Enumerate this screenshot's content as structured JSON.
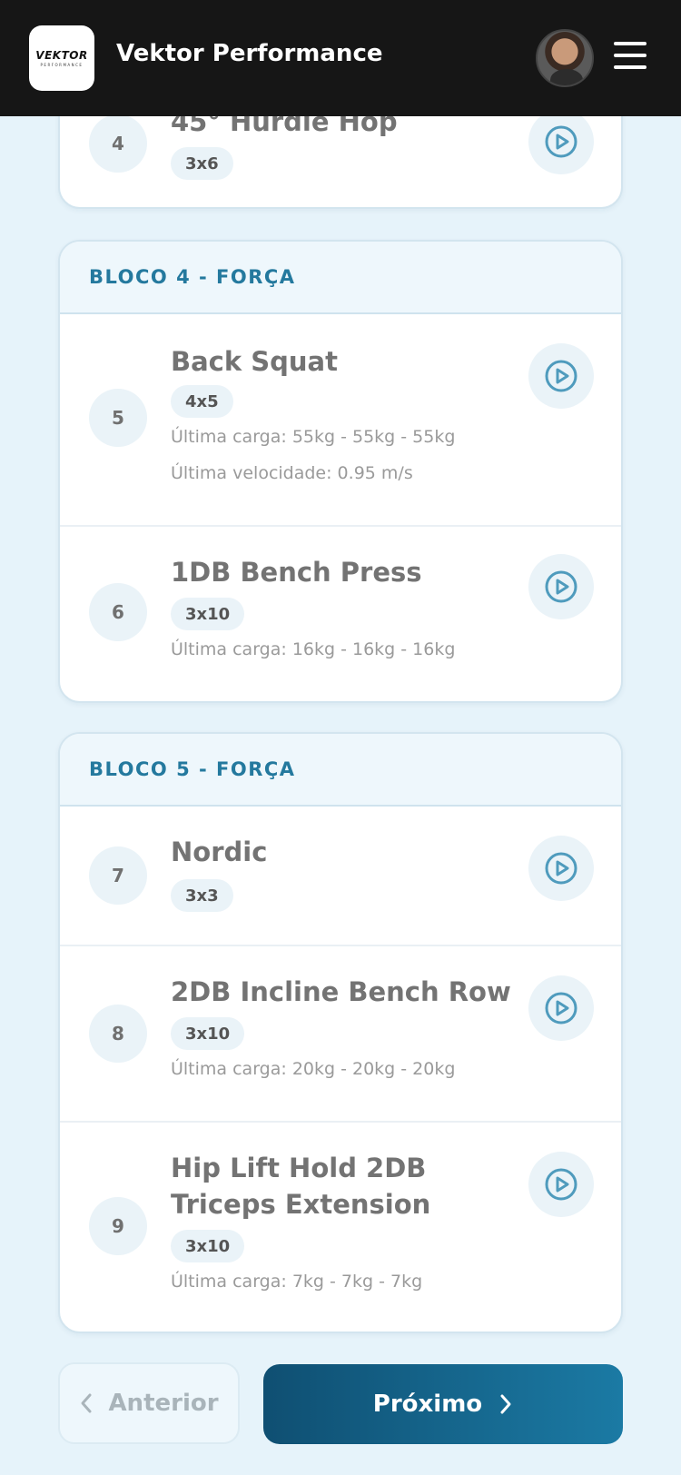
{
  "header": {
    "logo_text": "VEKTOR",
    "logo_subtext": "PERFORMANCE",
    "title": "Vektor Performance"
  },
  "top_card": {
    "exercise": {
      "number": "4",
      "name": "45° Hurdle Hop",
      "sets": "3x6"
    }
  },
  "blocks": [
    {
      "title": "BLOCO 4 - FORÇA",
      "exercises": [
        {
          "number": "5",
          "name": "Back Squat",
          "sets": "4x5",
          "last_load": "Última carga: 55kg - 55kg - 55kg",
          "last_velocity": "Última velocidade: 0.95 m/s"
        },
        {
          "number": "6",
          "name": "1DB Bench Press",
          "sets": "3x10",
          "last_load": "Última carga: 16kg - 16kg - 16kg"
        }
      ]
    },
    {
      "title": "BLOCO 5 - FORÇA",
      "exercises": [
        {
          "number": "7",
          "name": "Nordic",
          "sets": "3x3"
        },
        {
          "number": "8",
          "name": "2DB Incline Bench Row",
          "sets": "3x10",
          "last_load": "Última carga: 20kg - 20kg - 20kg"
        },
        {
          "number": "9",
          "name": "Hip Lift Hold 2DB Triceps Extension",
          "sets": "3x10",
          "last_load": "Última carga: 7kg - 7kg - 7kg"
        }
      ]
    }
  ],
  "navigation": {
    "prev_label": "Anterior",
    "next_label": "Próximo"
  },
  "colors": {
    "accent": "#24799e",
    "header_bg": "#161616",
    "page_bg": "#e6f3fa",
    "play_icon": "#4f9bbd"
  },
  "icons": [
    "menu-icon",
    "play-icon",
    "chevron-left-icon",
    "chevron-right-icon"
  ]
}
